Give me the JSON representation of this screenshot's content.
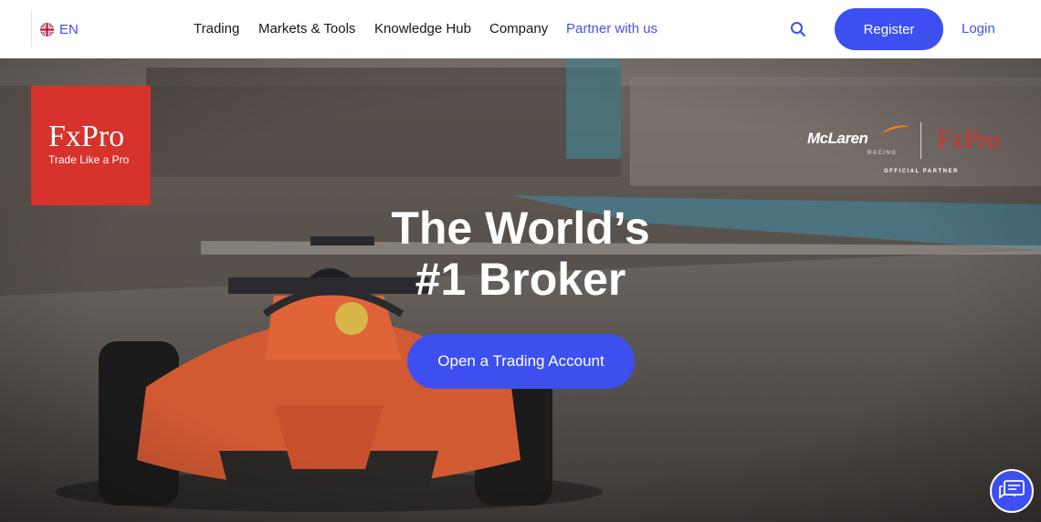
{
  "nav": {
    "language": {
      "flag_icon": "uk-flag-icon",
      "label": "EN"
    },
    "links": [
      {
        "label": "Trading"
      },
      {
        "label": "Markets & Tools"
      },
      {
        "label": "Knowledge Hub"
      },
      {
        "label": "Company"
      },
      {
        "label": "Partner with us"
      }
    ],
    "search_icon": "search-icon",
    "register_label": "Register",
    "login_label": "Login"
  },
  "hero": {
    "logo": {
      "name": "FxPro",
      "tagline": "Trade Like a Pro"
    },
    "partner_logo": {
      "brand": "McLaren",
      "sub": "RACING",
      "partner": "FxPro",
      "badge": "OFFICIAL PARTNER"
    },
    "title_line1": "The World’s",
    "title_line2": "#1 Broker",
    "cta_label": "Open a Trading Account",
    "chat_icon": "chat-icon"
  },
  "colors": {
    "accent": "#3d4ff0",
    "brand_red": "#d7322b",
    "text_dark": "#16161d"
  }
}
